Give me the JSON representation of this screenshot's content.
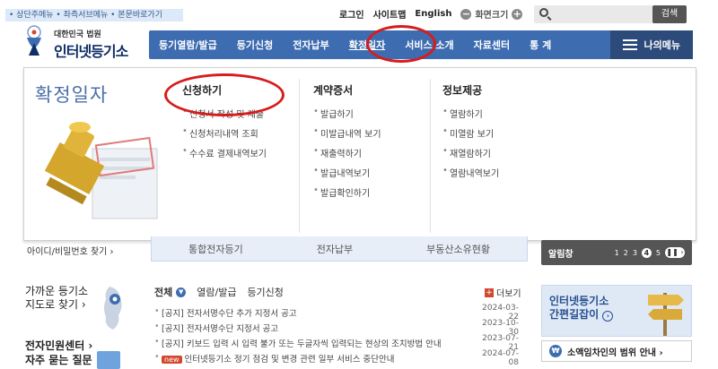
{
  "header": {
    "skip_links": "• 상단주메뉴 • 좌측서브메뉴 • 본문바로가기",
    "login": "로그인",
    "sitemap": "사이트맵",
    "english": "English",
    "zoom_label": "화면크기",
    "zoom_minus": "−",
    "zoom_plus": "+",
    "search_button": "검색",
    "search_placeholder": ""
  },
  "logo": {
    "small": "대한민국 법원",
    "big": "인터넷등기소"
  },
  "gnb": {
    "items": [
      "등기열람/발급",
      "등기신청",
      "전자납부",
      "확정일자",
      "서비스 소개",
      "자료센터",
      "통 계"
    ],
    "my_menu": "나의메뉴"
  },
  "dropdown": {
    "title": "확정일자",
    "columns": [
      {
        "heading": "신청하기",
        "items": [
          "신청서 작성 및 제출",
          "신청처리내역 조회",
          "수수료 결제내역보기"
        ]
      },
      {
        "heading": "계약증서",
        "items": [
          "발급하기",
          "미발급내역 보기",
          "재출력하기",
          "발급내역보기",
          "발급확인하기"
        ]
      },
      {
        "heading": "정보제공",
        "items": [
          "열람하기",
          "미열람 보기",
          "재열람하기",
          "열람내역보기"
        ]
      }
    ]
  },
  "below": {
    "id_find": "아이디/비밀번호 찾기 ›",
    "quick": [
      "통합전자등기",
      "전자납부",
      "부동산소유현황"
    ],
    "alarm_label": "알림창",
    "alarm_pages": [
      "1",
      "2",
      "3",
      "4",
      "5"
    ],
    "alarm_current": "4",
    "nearby_line1": "가까운 등기소",
    "nearby_line2": "지도로 찾기 ›",
    "civil_line1": "전자민원센터 ›",
    "civil_line2": "자주 묻는 질문"
  },
  "notice_tabs": {
    "all": "전체",
    "tab1": "열람/발급",
    "tab2": "등기신청",
    "more": "더보기"
  },
  "notices": [
    {
      "title": "[공지] 전자서명수단 추가 지정서 공고",
      "date": "2024-03-22",
      "is_new": false
    },
    {
      "title": "[공지] 전자서명수단 지정서 공고",
      "date": "2023-10-30",
      "is_new": false
    },
    {
      "title": "[공지] 키보드 입력 시 입력 불가 또는 두글자씩 입력되는 현상의 조치방법 안내",
      "date": "2023-07-21",
      "is_new": false
    },
    {
      "title": "인터넷등기소 정기 점검 및 변경 관련 일부 서비스 중단안내",
      "date": "2024-07-08",
      "is_new": true,
      "badge": "new"
    }
  ],
  "side": {
    "guide_line1": "인터넷등기소",
    "guide_line2": "간편길잡이",
    "smallbiz": "소액임차인의 범위 안내 ›"
  },
  "colors": {
    "gnb": "#3d6cb0",
    "highlight_ring": "#d71c1c",
    "title_blue": "#4b6fa8"
  }
}
